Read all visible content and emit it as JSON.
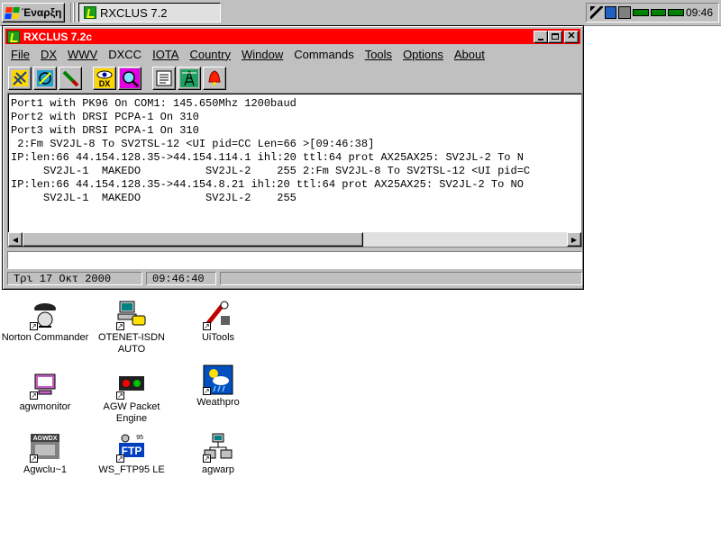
{
  "taskbar": {
    "start_label": "Έναρξη",
    "task_label": "RXCLUS 7.2",
    "clock": "09:46"
  },
  "window": {
    "title": "RXCLUS 7.2c",
    "menu": [
      "File",
      "DX",
      "WWV",
      "DXCC",
      "IOTA",
      "Country",
      "Window",
      "Commands",
      "Tools",
      "Options",
      "About"
    ],
    "output_lines": [
      "Port1 with PK96 On COM1: 145.650Mhz 1200baud",
      "Port2 with DRSI PCPA-1 On 310",
      "Port3 with DRSI PCPA-1 On 310",
      " 2:Fm SV2JL-8 To SV2TSL-12 <UI pid=CC Len=66 >[09:46:38]",
      "IP:len:66 44.154.128.35->44.154.114.1 ihl:20 ttl:64 prot AX25AX25: SV2JL-2 To N",
      "     SV2JL-1  MAKEDO          SV2JL-2    255 2:Fm SV2JL-8 To SV2TSL-12 <UI pid=C",
      "IP:len:66 44.154.128.35->44.154.8.21 ihl:20 ttl:64 prot AX25AX25: SV2JL-2 To NO",
      "     SV2JL-1  MAKEDO          SV2JL-2    255"
    ],
    "command_value": "",
    "status": {
      "date": "Τρι 17 Οκτ 2000",
      "time": "09:46:40"
    }
  },
  "desktop_icons": [
    {
      "label": "Norton Commander"
    },
    {
      "label": "OTENET-ISDN AUTO"
    },
    {
      "label": "UiTools"
    },
    {
      "label": "agwmonitor"
    },
    {
      "label": "AGW Packet Engine"
    },
    {
      "label": "Weathpro"
    },
    {
      "label": "Agwclu~1"
    },
    {
      "label": "WS_FTP95 LE"
    },
    {
      "label": "agwarp"
    }
  ]
}
